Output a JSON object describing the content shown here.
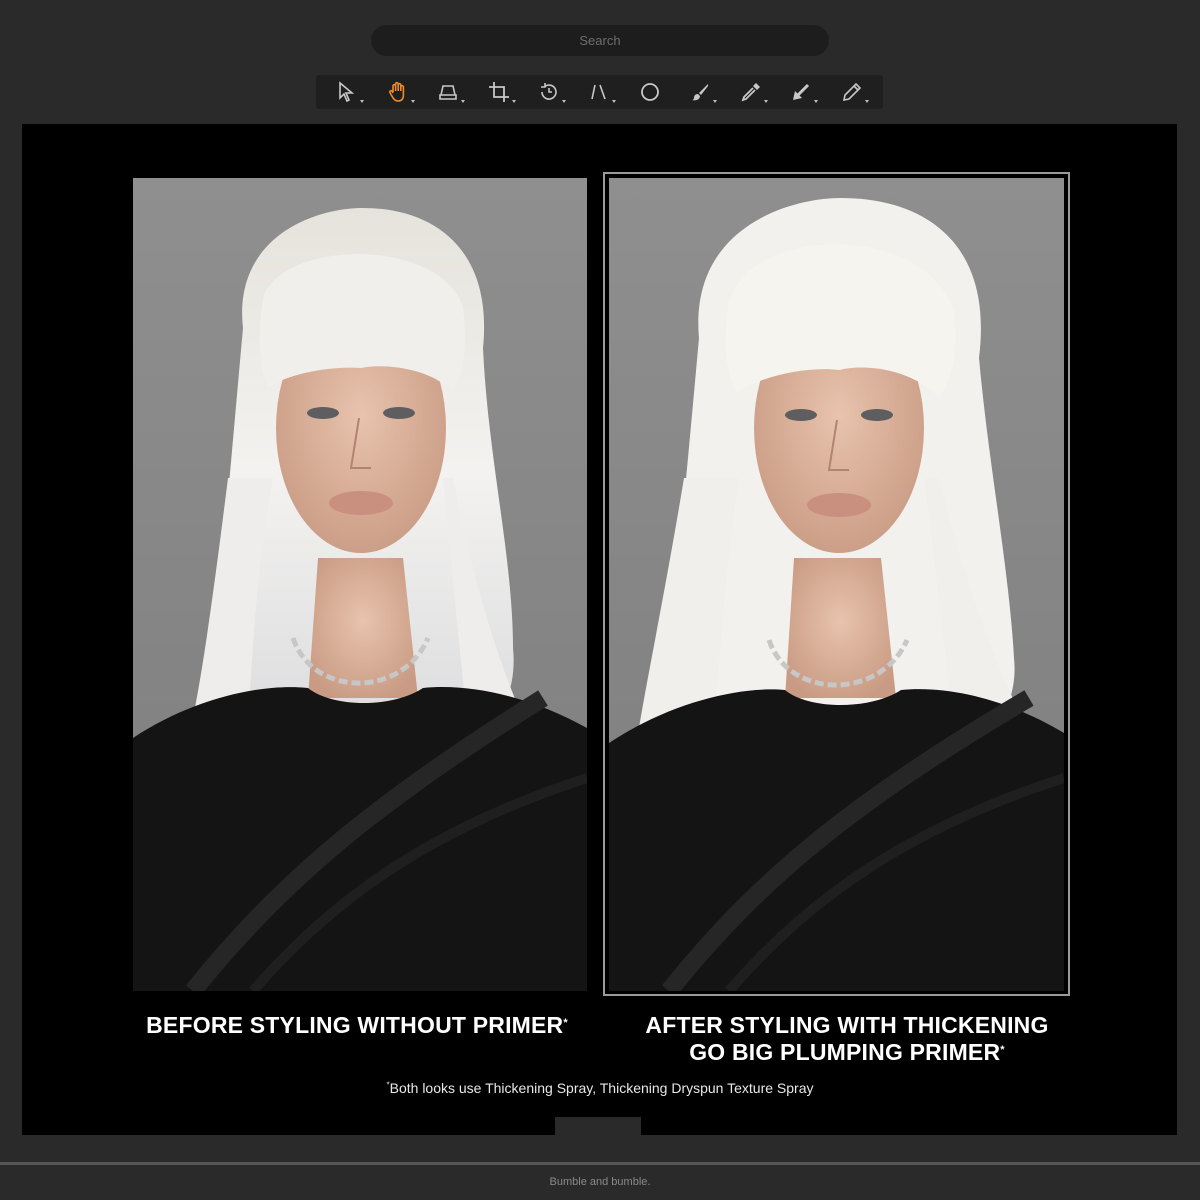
{
  "search": {
    "placeholder": "Search"
  },
  "toolbar": {
    "tools": [
      {
        "name": "select-arrow-icon",
        "active": false
      },
      {
        "name": "hand-icon",
        "active": true
      },
      {
        "name": "stamp-icon",
        "active": false
      },
      {
        "name": "crop-icon",
        "active": false
      },
      {
        "name": "rotate-icon",
        "active": false
      },
      {
        "name": "perspective-lines-icon",
        "active": false
      },
      {
        "name": "ellipse-icon",
        "active": false
      },
      {
        "name": "brush-icon",
        "active": false
      },
      {
        "name": "eyedropper-icon",
        "active": false
      },
      {
        "name": "arrow-tool-icon",
        "active": false
      },
      {
        "name": "pencil-icon",
        "active": false
      }
    ],
    "active_color": "#f08a24",
    "icon_color": "#c8c8c8"
  },
  "panels": {
    "before_caption": "BEFORE STYLING WITHOUT PRIMER",
    "after_caption_line1": "AFTER STYLING WITH THICKENING",
    "after_caption_line2": "GO BIG PLUMPING PRIMER",
    "asterisk": "*"
  },
  "footnote": {
    "asterisk": "*",
    "text": "Both looks use Thickening Spray, Thickening Dryspun Texture Spray"
  },
  "status_bar": {
    "text": "Bumble and bumble."
  }
}
